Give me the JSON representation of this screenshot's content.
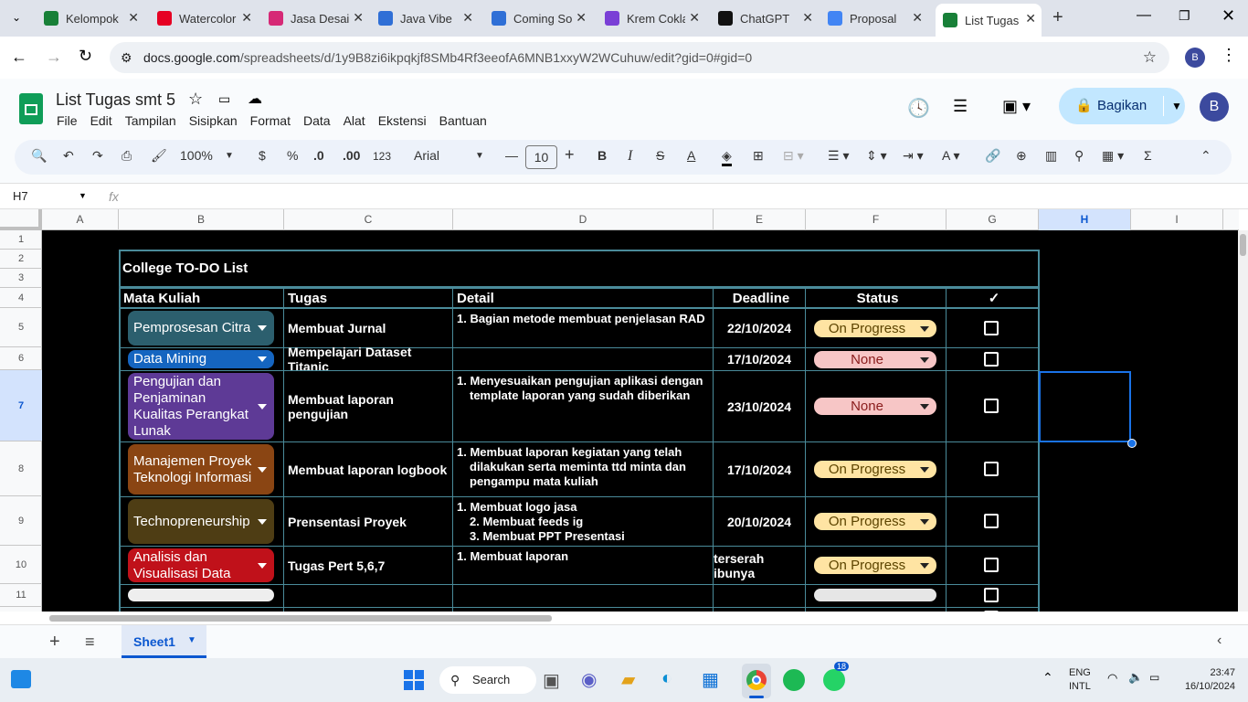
{
  "browser": {
    "tabs": [
      {
        "label": "Kelompok",
        "color": "#188038"
      },
      {
        "label": "Watercolor",
        "color": "#e60023"
      },
      {
        "label": "Jasa Desain",
        "color": "#d62976"
      },
      {
        "label": "Java Vibe",
        "color": "#2f6fd6"
      },
      {
        "label": "Coming Soon",
        "color": "#2f6fd6"
      },
      {
        "label": "Krem Coklat",
        "color": "#7a3fd6"
      },
      {
        "label": "ChatGPT",
        "color": "#111111"
      },
      {
        "label": "Proposal",
        "color": "#4285f4"
      },
      {
        "label": "List Tugas",
        "color": "#188038"
      }
    ],
    "url_host": "docs.google.com",
    "url_path": "/spreadsheets/d/1y9B8zi6ikpqkjf8SMb4Rf3eeofA6MNB1xxyW2WCuhuw/edit?gid=0#gid=0",
    "profile": "B"
  },
  "doc": {
    "title": "List Tugas smt 5",
    "menu": [
      "File",
      "Edit",
      "Tampilan",
      "Sisipkan",
      "Format",
      "Data",
      "Alat",
      "Ekstensi",
      "Bantuan"
    ],
    "share_label": "Bagikan",
    "avatar": "B"
  },
  "toolbar": {
    "zoom": "100%",
    "currency": "$",
    "percent": "%",
    "dec_dec": ".0",
    "inc_dec": ".00",
    "num_fmt": "123",
    "font": "Arial",
    "font_size": "10"
  },
  "formula": {
    "cell_ref": "H7",
    "fx": "fx"
  },
  "columns": [
    "A",
    "B",
    "C",
    "D",
    "E",
    "F",
    "G",
    "H",
    "I"
  ],
  "rows": [
    "1",
    "2",
    "3",
    "4",
    "5",
    "6",
    "7",
    "8",
    "9",
    "10",
    "11"
  ],
  "sheet": {
    "title": "College TO-DO List",
    "headers": [
      "Mata Kuliah",
      "Tugas",
      "Detail",
      "Deadline",
      "Status",
      "✓"
    ],
    "rows": [
      {
        "course": "Pemprosesan Citra",
        "course_color": "#2c5f6e",
        "task": "Membuat Jurnal",
        "detail": "1. Bagian metode membuat penjelasan RAD",
        "deadline": "22/10/2024",
        "status": "On Progress",
        "status_bg": "#ffe4a3",
        "status_fg": "#5c4400",
        "checked": false
      },
      {
        "course": "Data Mining",
        "course_color": "#1565c0",
        "task": "Mempelajari Dataset Titanic",
        "detail": "",
        "deadline": "17/10/2024",
        "status": "None",
        "status_bg": "#f7c6c6",
        "status_fg": "#8a1c1c",
        "checked": false
      },
      {
        "course": "Pengujian dan Penjaminan Kualitas Perangkat Lunak",
        "course_color": "#5e3a96",
        "task": "Membuat laporan pengujian",
        "detail": "1. Menyesuaikan pengujian aplikasi dengan template laporan yang sudah diberikan",
        "deadline": "23/10/2024",
        "status": "None",
        "status_bg": "#f7c6c6",
        "status_fg": "#8a1c1c",
        "checked": false
      },
      {
        "course": "Manajemen Proyek Teknologi Informasi",
        "course_color": "#8a4513",
        "task": "Membuat laporan logbook",
        "detail": "1. Membuat laporan kegiatan yang telah dilakukan serta meminta ttd minta dan pengampu mata kuliah",
        "deadline": "17/10/2024",
        "status": "On Progress",
        "status_bg": "#ffe4a3",
        "status_fg": "#5c4400",
        "checked": false
      },
      {
        "course": "Technopreneurship",
        "course_color": "#4e3d14",
        "task": "Prensentasi Proyek",
        "detail": "1. Membuat logo jasa\n2. Membuat feeds ig\n3. Membuat PPT Presentasi",
        "deadline": "20/10/2024",
        "status": "On Progress",
        "status_bg": "#ffe4a3",
        "status_fg": "#5c4400",
        "checked": false
      },
      {
        "course": "Analisis dan Visualisasi Data",
        "course_color": "#c0111a",
        "task": "Tugas Pert 5,6,7",
        "detail": "1. Membuat laporan",
        "deadline": "terserah ibunya",
        "status": "On Progress",
        "status_bg": "#ffe4a3",
        "status_fg": "#5c4400",
        "checked": false
      }
    ]
  },
  "sheet_tab": "Sheet1",
  "taskbar": {
    "search": "Search",
    "lang": "ENG",
    "lang2": "INTL",
    "time": "23:47",
    "date": "16/10/2024",
    "badge": "18"
  }
}
